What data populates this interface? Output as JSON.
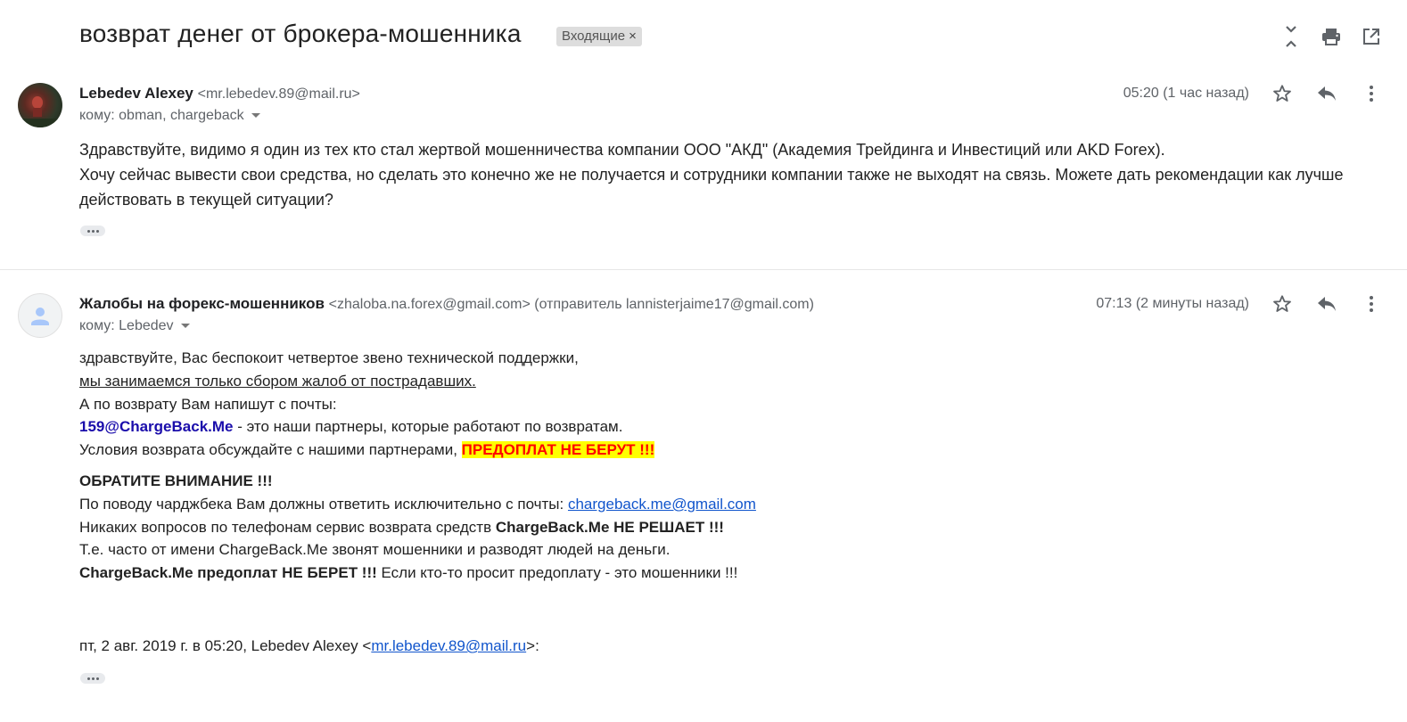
{
  "subject": "возврат денег от брокера-мошенника",
  "label": {
    "text": "Входящие",
    "close": "×"
  },
  "toolbar": {
    "collapse_icon": "collapse-all-icon",
    "print_icon": "print-icon",
    "popout_icon": "open-in-new-window-icon"
  },
  "message1": {
    "sender_name": "Lebedev Alexey",
    "sender_email": "<mr.lebedev.89@mail.ru>",
    "to": "кому: obman, chargeback",
    "time": "05:20 (1 час назад)",
    "body_line1": "Здравствуйте, видимо я один из тех кто стал жертвой мошенничества компании ООО \"АКД\" (Академия Трейдинга и Инвестиций или AKD Forex).",
    "body_line2": "Хочу сейчас вывести свои средства, но сделать это конечно же не получается и сотрудники компании также не выходят на связь. Можете дать рекомендации как лучше действовать в текущей ситуации?"
  },
  "message2": {
    "sender_name": "Жалобы на форекс-мошенников",
    "sender_email": "<zhaloba.na.forex@gmail.com> (отправитель lannisterjaime17@gmail.com)",
    "to": "кому: Lebedev",
    "time": "07:13 (2 минуты назад)",
    "line1": "здравствуйте, Вас беспокоит четвертое звено технической поддержки,",
    "line2": "мы занимаемся только сбором жалоб от пострадавших.",
    "line3": "А по возврату Вам напишут с почты:",
    "line4_email": "159@ChargeBack.Me",
    "line4_rest": " - это наши партнеры, которые работают по возвратам.",
    "line5_start": "Условия возврата обсуждайте с нашими партнерами, ",
    "line5_highlight": "ПРЕДОПЛАТ НЕ БЕРУТ !!!",
    "attention": "ОБРАТИТЕ ВНИМАНИЕ !!!",
    "line6_start": "По поводу чарджбека Вам должны ответить исключительно с почты: ",
    "line6_link": "chargeback.me@gmail.com",
    "line7_start": "Никаких вопросов по телефонам сервис возврата средств ",
    "line7_bold": "ChargeBack.Me НЕ РЕШАЕТ !!!",
    "line8": "Т.е. часто от имени ChargeBack.Ме звонят мошенники и разводят людей на деньги.",
    "line9_bold": "ChargeBack.Me предоплат НЕ БЕРЕТ !!!",
    "line9_rest": " Если кто-то просит предоплату - это мошенники !!!",
    "quote_start": "пт, 2 авг. 2019 г. в 05:20, Lebedev Alexey <",
    "quote_link": "mr.lebedev.89@mail.ru",
    "quote_end": ">:"
  }
}
